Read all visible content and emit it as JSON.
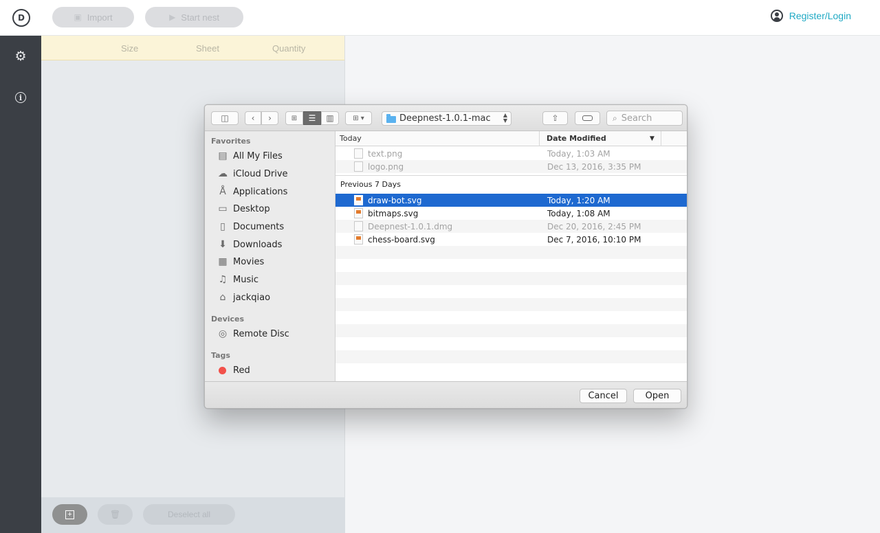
{
  "topbar": {
    "import_label": "Import",
    "start_nest_label": "Start nest",
    "register_label": "Register/Login"
  },
  "rail": {
    "icons": [
      "gear-icon",
      "info-icon"
    ]
  },
  "panel": {
    "columns": [
      "Size",
      "Sheet",
      "Quantity"
    ],
    "deselect_label": "Deselect all"
  },
  "dialog": {
    "location": "Deepnest-1.0.1-mac",
    "search_placeholder": "Search",
    "sidebar": {
      "favorites_label": "Favorites",
      "favorites": [
        {
          "label": "All My Files",
          "icon": "all-files-icon"
        },
        {
          "label": "iCloud Drive",
          "icon": "cloud-icon"
        },
        {
          "label": "Applications",
          "icon": "applications-icon"
        },
        {
          "label": "Desktop",
          "icon": "desktop-icon"
        },
        {
          "label": "Documents",
          "icon": "documents-icon"
        },
        {
          "label": "Downloads",
          "icon": "downloads-icon"
        },
        {
          "label": "Movies",
          "icon": "movies-icon"
        },
        {
          "label": "Music",
          "icon": "music-icon"
        },
        {
          "label": "jackqiao",
          "icon": "home-icon"
        }
      ],
      "devices_label": "Devices",
      "devices": [
        {
          "label": "Remote Disc",
          "icon": "disc-icon"
        }
      ],
      "tags_label": "Tags",
      "tags": [
        {
          "label": "Red",
          "color": "#f2514b"
        }
      ]
    },
    "columns": {
      "name": "Today",
      "date": "Date Modified"
    },
    "groups": [
      {
        "title": "Today",
        "files": [
          {
            "name": "text.png",
            "date": "Today, 1:03 AM",
            "state": "dim"
          },
          {
            "name": "logo.png",
            "date": "Dec 13, 2016, 3:35 PM",
            "state": "dim"
          }
        ]
      },
      {
        "title": "Previous 7 Days",
        "files": [
          {
            "name": "draw-bot.svg",
            "date": "Today, 1:20 AM",
            "state": "selected"
          },
          {
            "name": "bitmaps.svg",
            "date": "Today, 1:08 AM",
            "state": "normal"
          },
          {
            "name": "Deepnest-1.0.1.dmg",
            "date": "Dec 20, 2016, 2:45 PM",
            "state": "dim"
          },
          {
            "name": "chess-board.svg",
            "date": "Dec 7, 2016, 10:10 PM",
            "state": "normal"
          }
        ]
      }
    ],
    "cancel_label": "Cancel",
    "open_label": "Open"
  },
  "colors": {
    "accent": "#1fa9c4",
    "rail": "#3b3f45",
    "selection": "#1e69d0",
    "panel_header": "#fbf4d8"
  }
}
